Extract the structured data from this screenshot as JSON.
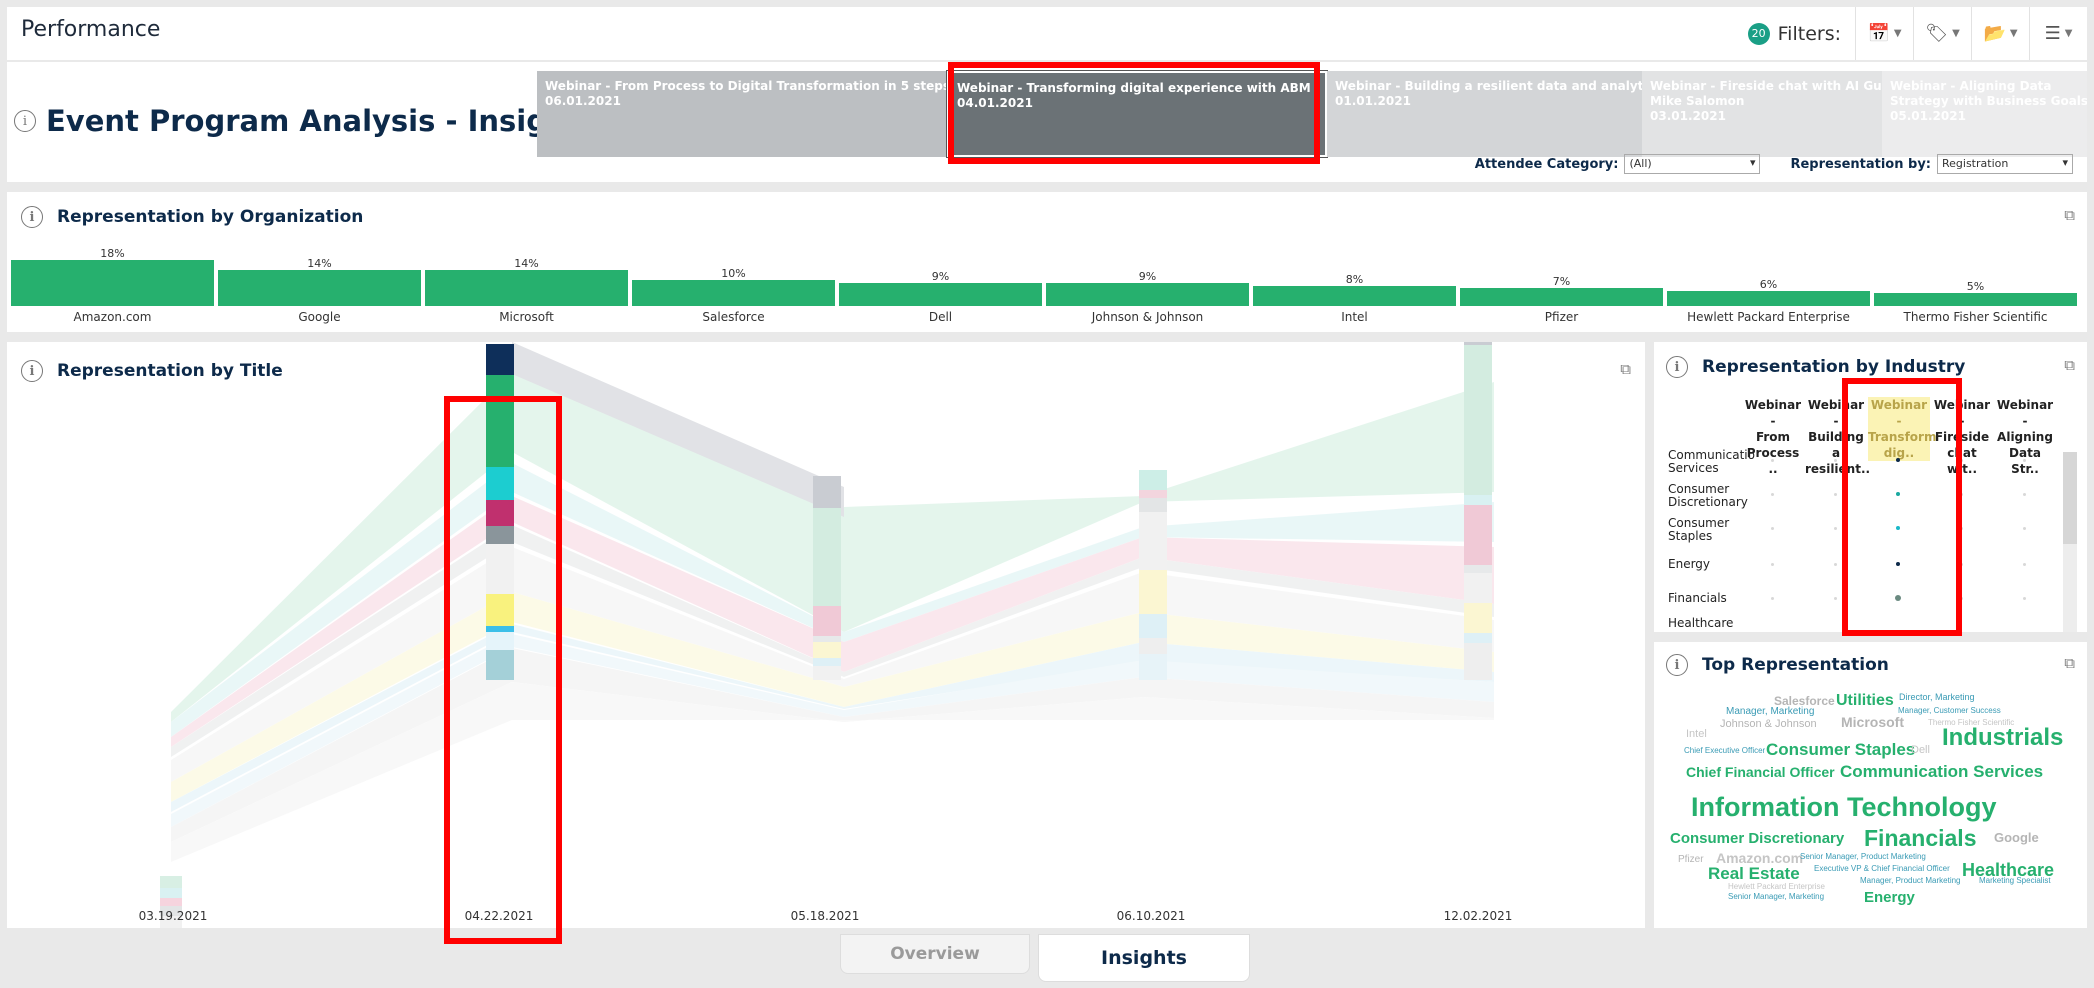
{
  "app": {
    "title": "Performance"
  },
  "filters": {
    "count": "20",
    "label": "Filters:"
  },
  "header": {
    "title": "Event Program Analysis - Insights",
    "events": [
      {
        "line1": "Webinar - From Process to Digital Transformation in 5 steps",
        "line2": "06.01.2021",
        "line3": ""
      },
      {
        "line1": "Webinar - Transforming digital experience with ABM",
        "line2": "04.01.2021",
        "line3": ""
      },
      {
        "line1": "Webinar - Building a resilient data and analytics strategy",
        "line2": "01.01.2021",
        "line3": ""
      },
      {
        "line1": "Webinar - Fireside chat with AI Guru",
        "line2": "Mike Salomon",
        "line3": "03.01.2021"
      },
      {
        "line1": "Webinar - Aligning Data",
        "line2": "Strategy with Business Goals",
        "line3": "05.01.2021"
      }
    ],
    "attendee_category_label": "Attendee Category:",
    "attendee_category_value": "(All)",
    "representation_by_label": "Representation by:",
    "representation_by_value": "Registration"
  },
  "org_panel": {
    "title": "Representation by Organization",
    "items": [
      {
        "name": "Amazon.com",
        "pct": "18%",
        "value": 18
      },
      {
        "name": "Google",
        "pct": "14%",
        "value": 14
      },
      {
        "name": "Microsoft",
        "pct": "14%",
        "value": 14
      },
      {
        "name": "Salesforce",
        "pct": "10%",
        "value": 10
      },
      {
        "name": "Dell",
        "pct": "9%",
        "value": 9
      },
      {
        "name": "Johnson & Johnson",
        "pct": "9%",
        "value": 9
      },
      {
        "name": "Intel",
        "pct": "8%",
        "value": 8
      },
      {
        "name": "Pfizer",
        "pct": "7%",
        "value": 7
      },
      {
        "name": "Hewlett Packard Enterprise",
        "pct": "6%",
        "value": 6
      },
      {
        "name": "Thermo Fisher Scientific",
        "pct": "5%",
        "value": 5
      }
    ]
  },
  "title_panel": {
    "title": "Representation by Title",
    "dates": [
      "03.19.2021",
      "04.22.2021",
      "05.18.2021",
      "06.10.2021",
      "12.02.2021"
    ]
  },
  "industry_panel": {
    "title": "Representation by Industry",
    "columns": [
      {
        "l1": "Webinar -",
        "l2": "From",
        "l3": "Process .."
      },
      {
        "l1": "Webinar -",
        "l2": "Building a",
        "l3": "resilient.."
      },
      {
        "l1": "Webinar -",
        "l2": "Transform",
        "l3": "dig.."
      },
      {
        "l1": "Webinar -",
        "l2": "Fireside",
        "l3": "chat wit.."
      },
      {
        "l1": "Webinar -",
        "l2": "Aligning",
        "l3": "Data Str.."
      }
    ],
    "rows": [
      {
        "l1": "Communicatio",
        "l2": "Services"
      },
      {
        "l1": "Consumer",
        "l2": "Discretionary"
      },
      {
        "l1": "Consumer",
        "l2": "Staples"
      },
      {
        "l1": "Energy",
        "l2": ""
      },
      {
        "l1": "Financials",
        "l2": ""
      },
      {
        "l1": "Healthcare",
        "l2": ""
      }
    ]
  },
  "top_rep_panel": {
    "title": "Top Representation",
    "words": [
      "Salesforce",
      "Utilities",
      "Director, Marketing",
      "Manager, Marketing",
      "Manager, Customer Success",
      "Johnson & Johnson",
      "Microsoft",
      "Thermo Fisher Scientific",
      "Intel",
      "Industrials",
      "Chief Executive Officer",
      "Consumer Staples",
      "Dell",
      "Chief Financial Officer",
      "Communication Services",
      "Information Technology",
      "Consumer Discretionary",
      "Financials",
      "Google",
      "Pfizer",
      "Amazon.com",
      "Senior Manager, Product Marketing",
      "Executive VP & Chief Financial Officer",
      "Real Estate",
      "Healthcare",
      "Hewlett Packard Enterprise",
      "Manager, Product Marketing",
      "Marketing Specialist",
      "Senior Manager, Marketing",
      "Energy"
    ]
  },
  "tabs": {
    "overview": "Overview",
    "insights": "Insights"
  },
  "colors": {
    "accent_green": "#26b06e",
    "highlight_red": "#ff0000",
    "navy": "#0d2a4a"
  }
}
